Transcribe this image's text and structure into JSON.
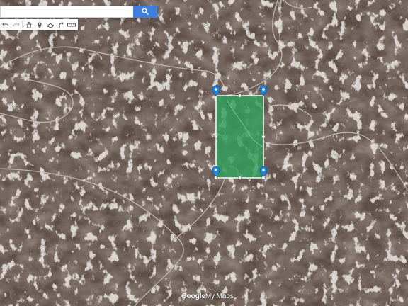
{
  "map": {
    "view": "satellite",
    "polygon_fill_color": "#2fa05a",
    "polygon_stroke_color": "#ffffff",
    "marker_color": "#1e88e5",
    "terrain_colors": {
      "base": "#5b4d45",
      "ridge_light": "#a79d93",
      "shadow": "#3c302a",
      "road": "#c9c2b8"
    }
  },
  "search": {
    "value": "",
    "placeholder": "",
    "button_icon": "search-icon"
  },
  "toolbar": {
    "tools": [
      "undo-icon",
      "redo-icon",
      "hand-pan-icon",
      "marker-icon",
      "draw-line-icon",
      "route-icon",
      "ruler-icon"
    ]
  },
  "attribution": {
    "brand": "Google",
    "product": "My Maps"
  }
}
